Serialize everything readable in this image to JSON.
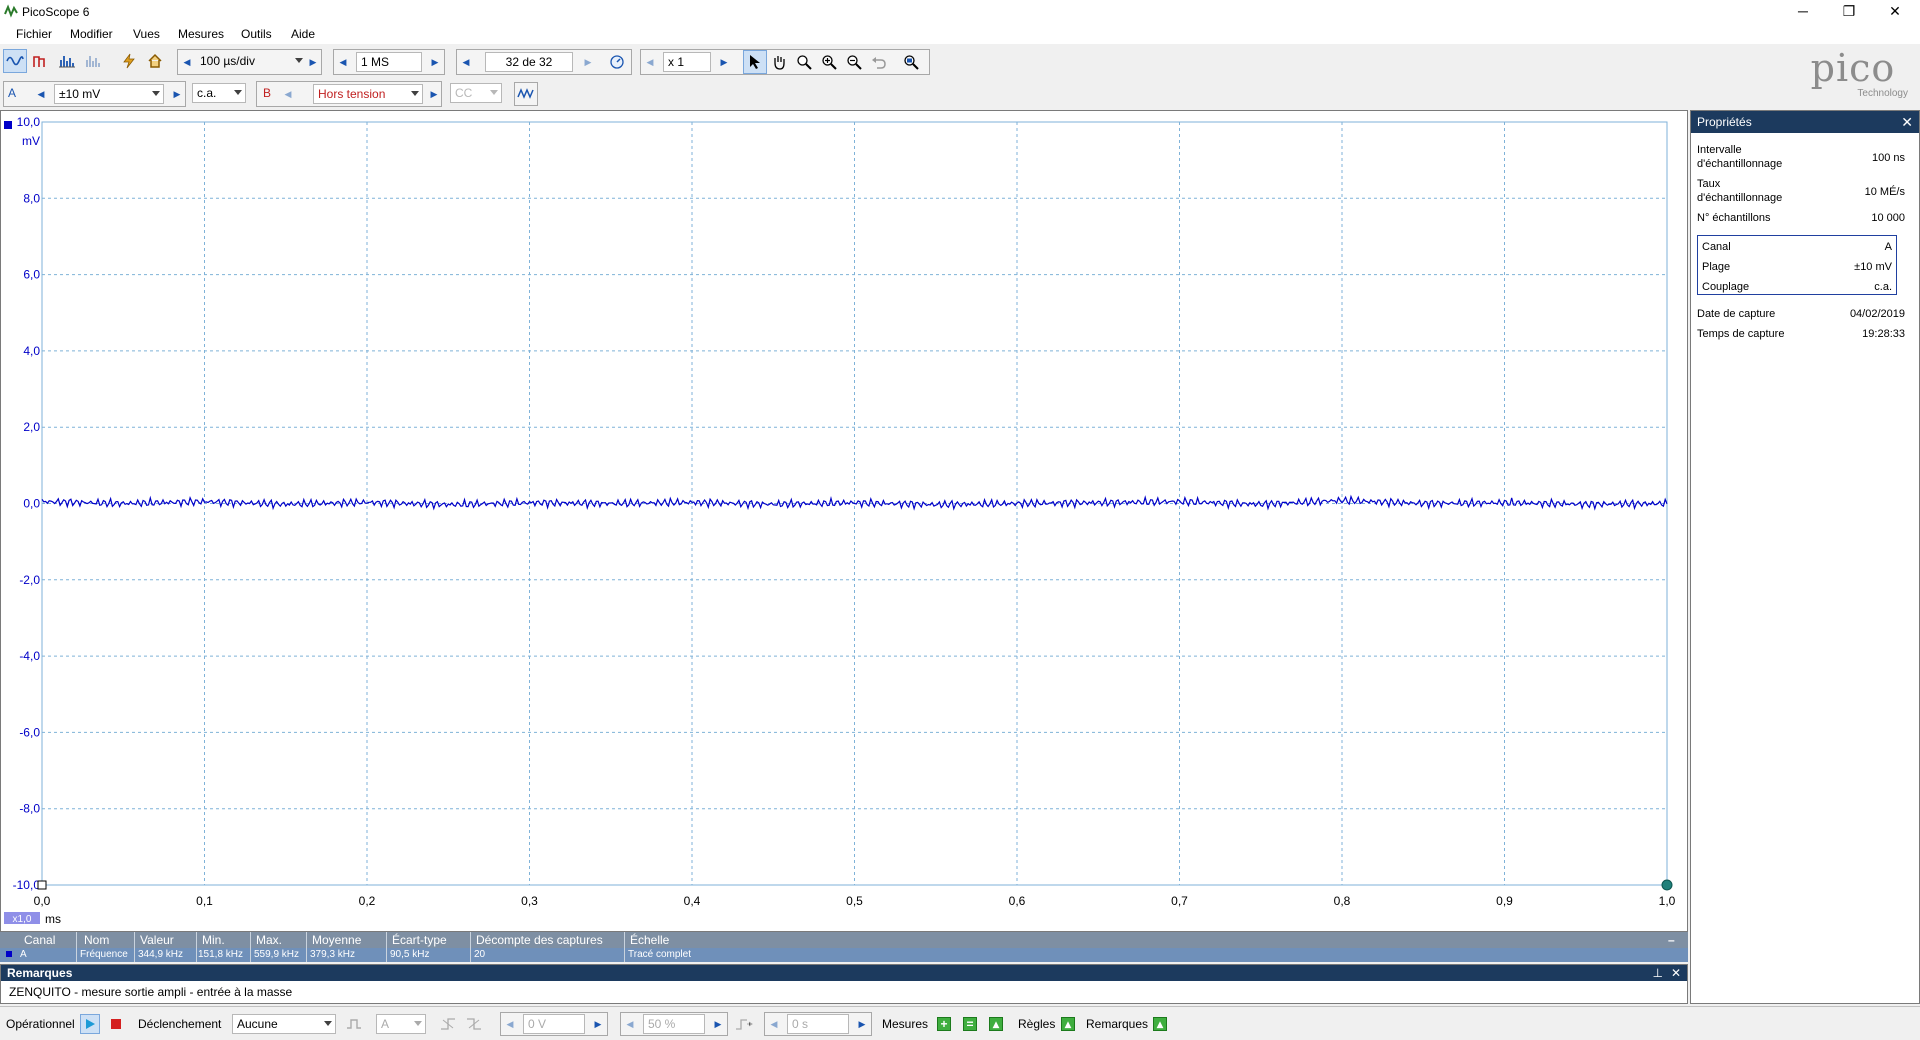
{
  "window": {
    "title": "PicoScope 6",
    "minimize_glyph": "─",
    "restore_glyph": "❐",
    "close_glyph": "✕"
  },
  "menu": [
    "Fichier",
    "Modifier",
    "Vues",
    "Mesures",
    "Outils",
    "Aide"
  ],
  "toolbar1": {
    "timebase": "100 µs/div",
    "samples": "1 MS",
    "capture_index": "32 de 32",
    "zoom": "x 1"
  },
  "toolbar2": {
    "channel_a_label": "A",
    "channel_a_range": "±10 mV",
    "channel_a_coupling": "c.a.",
    "channel_b_label": "B",
    "channel_b_range": "Hors tension",
    "channel_b_coupling": "CC"
  },
  "logo": {
    "text": "pico",
    "subtext": "Technology"
  },
  "scope": {
    "channel_marker": "A",
    "y_unit": "mV",
    "x_unit": "ms",
    "x_zoom_badge": "x1,0",
    "accent": "#0000c8",
    "grid_color": "#7fb2d8"
  },
  "chart_data": {
    "type": "line",
    "title": "",
    "xlabel": "ms",
    "ylabel": "mV",
    "xlim": [
      0.0,
      1.0
    ],
    "ylim": [
      -10.0,
      10.0
    ],
    "grid": true,
    "x_ticks": [
      "0,0",
      "0,1",
      "0,2",
      "0,3",
      "0,4",
      "0,5",
      "0,6",
      "0,7",
      "0,8",
      "0,9",
      "1,0"
    ],
    "y_ticks": [
      "10,0",
      "8,0",
      "6,0",
      "4,0",
      "2,0",
      "0,0",
      "-2,0",
      "-4,0",
      "-6,0",
      "-8,0",
      "-10,0"
    ],
    "series": [
      {
        "name": "A",
        "color": "#0000c8",
        "x": [
          0.0,
          0.05,
          0.1,
          0.15,
          0.2,
          0.25,
          0.3,
          0.35,
          0.4,
          0.45,
          0.5,
          0.55,
          0.6,
          0.65,
          0.7,
          0.75,
          0.8,
          0.85,
          0.9,
          0.95,
          1.0
        ],
        "y": [
          0.05,
          0.0,
          0.05,
          -0.02,
          0.03,
          -0.03,
          0.02,
          0.0,
          0.03,
          -0.02,
          0.02,
          -0.03,
          0.0,
          0.02,
          0.05,
          -0.02,
          0.08,
          0.0,
          0.02,
          -0.02,
          0.0
        ]
      }
    ]
  },
  "properties": {
    "title": "Propriétés",
    "close": "✕",
    "rows": [
      {
        "label1": "Intervalle",
        "label2": "d'échantillonnage",
        "value": "100 ns"
      },
      {
        "label1": "Taux",
        "label2": "d'échantillonnage",
        "value": "10 MÉ/s"
      },
      {
        "label1": "N° échantillons",
        "label2": "",
        "value": "10 000"
      }
    ],
    "channel_box": [
      {
        "label": "Canal",
        "value": "A"
      },
      {
        "label": "Plage",
        "value": "±10 mV"
      },
      {
        "label": "Couplage",
        "value": "c.a."
      }
    ],
    "capture": [
      {
        "label": "Date de capture",
        "value": "04/02/2019"
      },
      {
        "label": "Temps de capture",
        "value": "19:28:33"
      }
    ]
  },
  "measurements": {
    "headers": [
      "Canal",
      "Nom",
      "Valeur",
      "Min.",
      "Max.",
      "Moyenne",
      "Écart-type",
      "Décompte des captures",
      "Échelle"
    ],
    "row": [
      "A",
      "Fréquence",
      "344,9 kHz",
      "151,8 kHz",
      "559,9 kHz",
      "379,3 kHz",
      "90,5 kHz",
      "20",
      "Tracé complet"
    ],
    "collapse": "–"
  },
  "notes": {
    "title": "Remarques",
    "text": "ZENQUITO - mesure sortie ampli - entrée à la masse",
    "pin": "⊥",
    "close": "✕"
  },
  "status": {
    "mode": "Opérationnel",
    "trigger_label": "Déclenchement",
    "trigger_value": "Aucune",
    "trigger_channel": "A",
    "trigger_level": "0 V",
    "pre_trigger": "50 %",
    "delay": "0 s",
    "measures": "Mesures",
    "rulers": "Règles",
    "notes": "Remarques"
  }
}
